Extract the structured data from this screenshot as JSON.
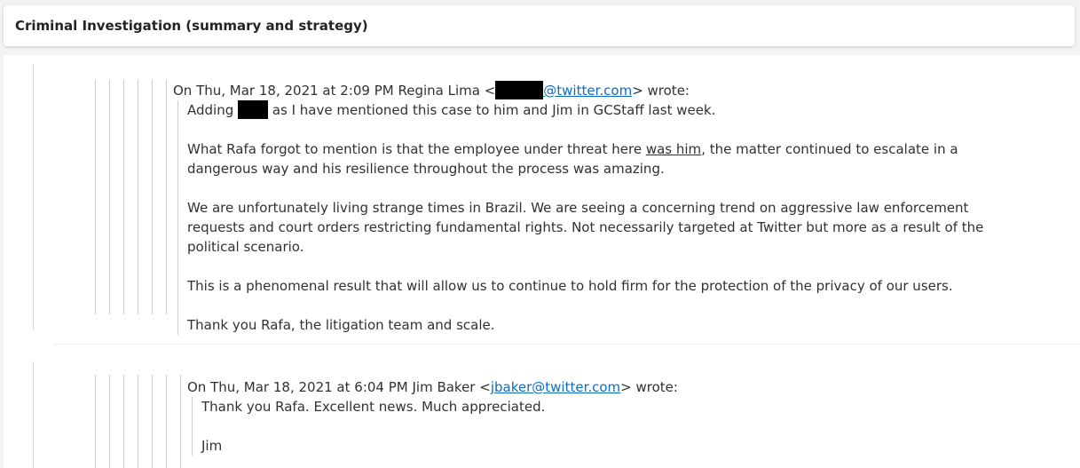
{
  "header": {
    "title": "Criminal Investigation (summary and strategy)"
  },
  "message1": {
    "attribution_prefix": "On Thu, Mar 18, 2021 at 2:09 PM Regina Lima <",
    "email_domain": "@twitter.com",
    "attribution_suffix": "> wrote:",
    "p1_before": "Adding",
    "p1_after": "as I have mentioned this case to him and Jim in GCStaff last week.",
    "p2_before": "What Rafa forgot to mention is that the employee under threat here",
    "p2_underlined": "was him",
    "p2_after": ", the matter continued to escalate in a dangerous way and his resilience throughout the process was amazing.",
    "p3": "We are unfortunately living strange times in Brazil. We are seeing a concerning trend on aggressive law enforcement requests and court orders restricting fundamental rights. Not necessarily targeted at Twitter but more as a result of the political scenario.",
    "p4": "This is a phenomenal result that will allow us to continue to hold firm for the protection of the privacy of our users.",
    "p5": "Thank you Rafa, the litigation team and scale."
  },
  "message2": {
    "attribution_prefix": "On Thu, Mar 18, 2021 at 6:04 PM Jim Baker <",
    "email": "jbaker@twitter.com",
    "attribution_suffix": "> wrote:",
    "p1": "Thank you Rafa. Excellent news. Much appreciated.",
    "p2": "Jim"
  }
}
